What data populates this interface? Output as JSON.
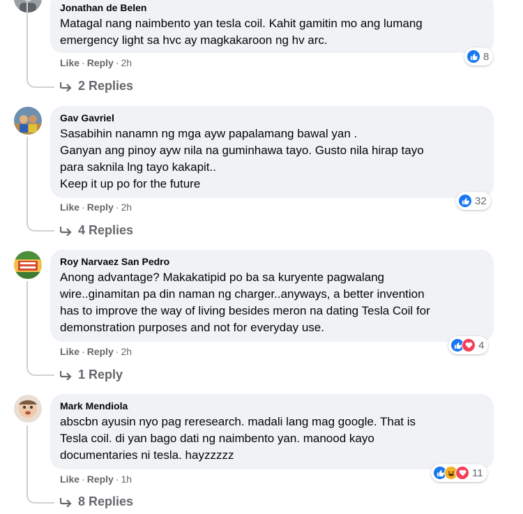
{
  "comments": [
    {
      "author": "Jonathan de Belen",
      "text": "Matagal nang naimbento yan tesla coil. Kahit gamitin mo ang lumang\nemergency light sa hvc ay magkakaroon ng hv arc.",
      "like_label": "Like",
      "reply_label": "Reply",
      "time": "2h",
      "reaction_count": "8",
      "reactions": [
        "like"
      ],
      "replies_label": "2 Replies"
    },
    {
      "author": "Gav Gavriel",
      "text": "Sasabihin nanamn ng mga ayw papalamang bawal yan .\nGanyan ang pinoy ayw nila na guminhawa tayo. Gusto nila hirap tayo\npara saknila lng tayo kakapit..\nKeep it up po for the future",
      "like_label": "Like",
      "reply_label": "Reply",
      "time": "2h",
      "reaction_count": "32",
      "reactions": [
        "like"
      ],
      "replies_label": "4 Replies"
    },
    {
      "author": "Roy Narvaez San Pedro",
      "text": "Anong advantage? Makakatipid po ba sa kuryente pagwalang\nwire..ginamitan pa din naman ng charger..anyways, a better invention\nhas to improve the way of living besides meron na dating Tesla Coil for\ndemonstration purposes and not for everyday use.",
      "like_label": "Like",
      "reply_label": "Reply",
      "time": "2h",
      "reaction_count": "4",
      "reactions": [
        "like",
        "love"
      ],
      "replies_label": "1 Reply"
    },
    {
      "author": "Mark Mendiola",
      "text": "abscbn ayusin nyo pag reresearch. madali lang mag google. That is\nTesla coil. di yan bago dati ng naimbento yan. manood kayo\ndocumentaries ni tesla. hayzzzzz",
      "like_label": "Like",
      "reply_label": "Reply",
      "time": "1h",
      "reaction_count": "11",
      "reactions": [
        "like",
        "haha",
        "love"
      ],
      "replies_label": "8 Replies"
    }
  ],
  "separator": "·",
  "colors": {
    "bubble": "#f0f2f5",
    "like_blue": "#1877f2",
    "love_red": "#f33e58",
    "haha_yellow": "#f7b125",
    "meta_gray": "#65676b"
  }
}
